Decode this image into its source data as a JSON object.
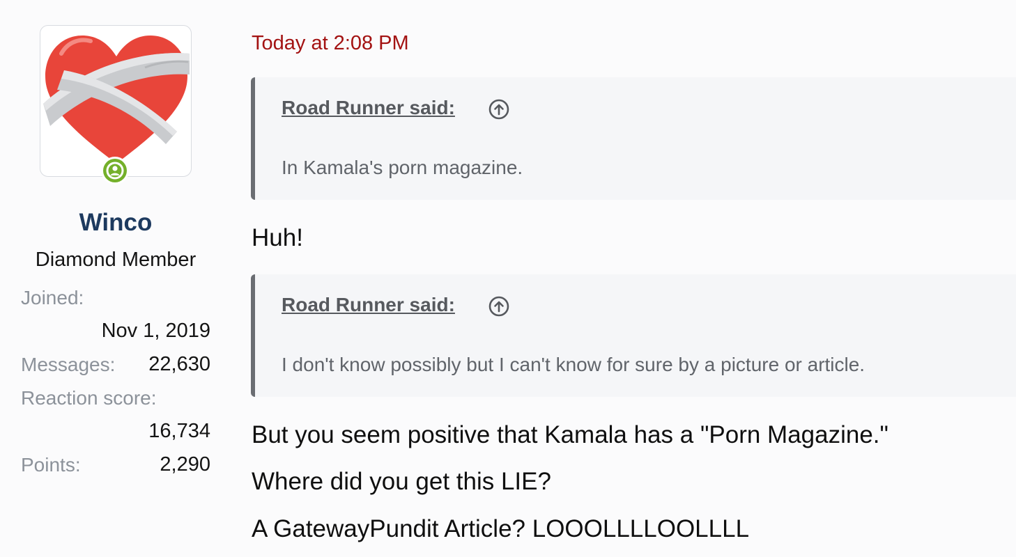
{
  "user": {
    "name": "Winco",
    "title": "Diamond Member",
    "avatar_icon": "bandaged-heart-emoji",
    "online_icon": "online-person-icon",
    "stats": {
      "joined_label": "Joined:",
      "joined_value": "Nov 1, 2019",
      "messages_label": "Messages:",
      "messages_value": "22,630",
      "reaction_label": "Reaction score:",
      "reaction_value": "16,734",
      "points_label": "Points:",
      "points_value": "2,290"
    }
  },
  "post": {
    "date": "Today at 2:08 PM",
    "quote1": {
      "author": "Road Runner said:",
      "icon": "circle-arrow-up-icon",
      "text": "In Kamala's porn magazine."
    },
    "reply1": "Huh!",
    "quote2": {
      "author": "Road Runner said:",
      "icon": "circle-arrow-up-icon",
      "text": "I don't know possibly but I can't know for sure by a picture or article."
    },
    "lines": [
      "But you seem positive that Kamala has a \"Porn Magazine.\"",
      "Where did you get this LIE?",
      "A GatewayPundit Article? LOOOLLLLOOLLLL"
    ]
  },
  "colors": {
    "username": "#1d3a5f",
    "date": "#a31212",
    "online": "#74b02a",
    "quote_border": "#6a6d72"
  }
}
